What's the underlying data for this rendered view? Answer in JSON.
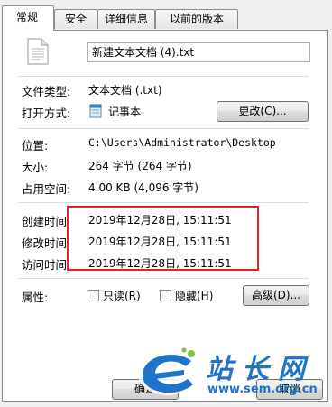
{
  "tabs": [
    "常规",
    "安全",
    "详细信息",
    "以前的版本"
  ],
  "file_name": "新建文本文档 (4).txt",
  "type": {
    "label": "文件类型:",
    "value": "文本文档 (.txt)"
  },
  "opens_with": {
    "label": "打开方式:",
    "app": "记事本",
    "change_button": "更改(C)..."
  },
  "location": {
    "label": "位置:",
    "value": "C:\\Users\\Administrator\\Desktop"
  },
  "size": {
    "label": "大小:",
    "value": "264 字节 (264 字节)"
  },
  "size_on_disk": {
    "label": "占用空间:",
    "value": "4.00 KB (4,096 字节)"
  },
  "created": {
    "label": "创建时间:",
    "value": "2019年12月28日, 15:11:51"
  },
  "modified": {
    "label": "修改时间:",
    "value": "2019年12月28日, 15:11:51"
  },
  "accessed": {
    "label": "访问时间:",
    "value": "2019年12月28日, 15:11:51"
  },
  "attributes": {
    "label": "属性:",
    "readonly": "只读(R)",
    "hidden": "隐藏(H)",
    "advanced_button": "高级(D)..."
  },
  "footer_buttons": [
    "确定",
    "取消"
  ],
  "watermark": {
    "brand": "站长网",
    "url": "www.sem.org.cn"
  },
  "colors": {
    "highlight": "#e3232c",
    "watermark": "#1d74c9"
  }
}
